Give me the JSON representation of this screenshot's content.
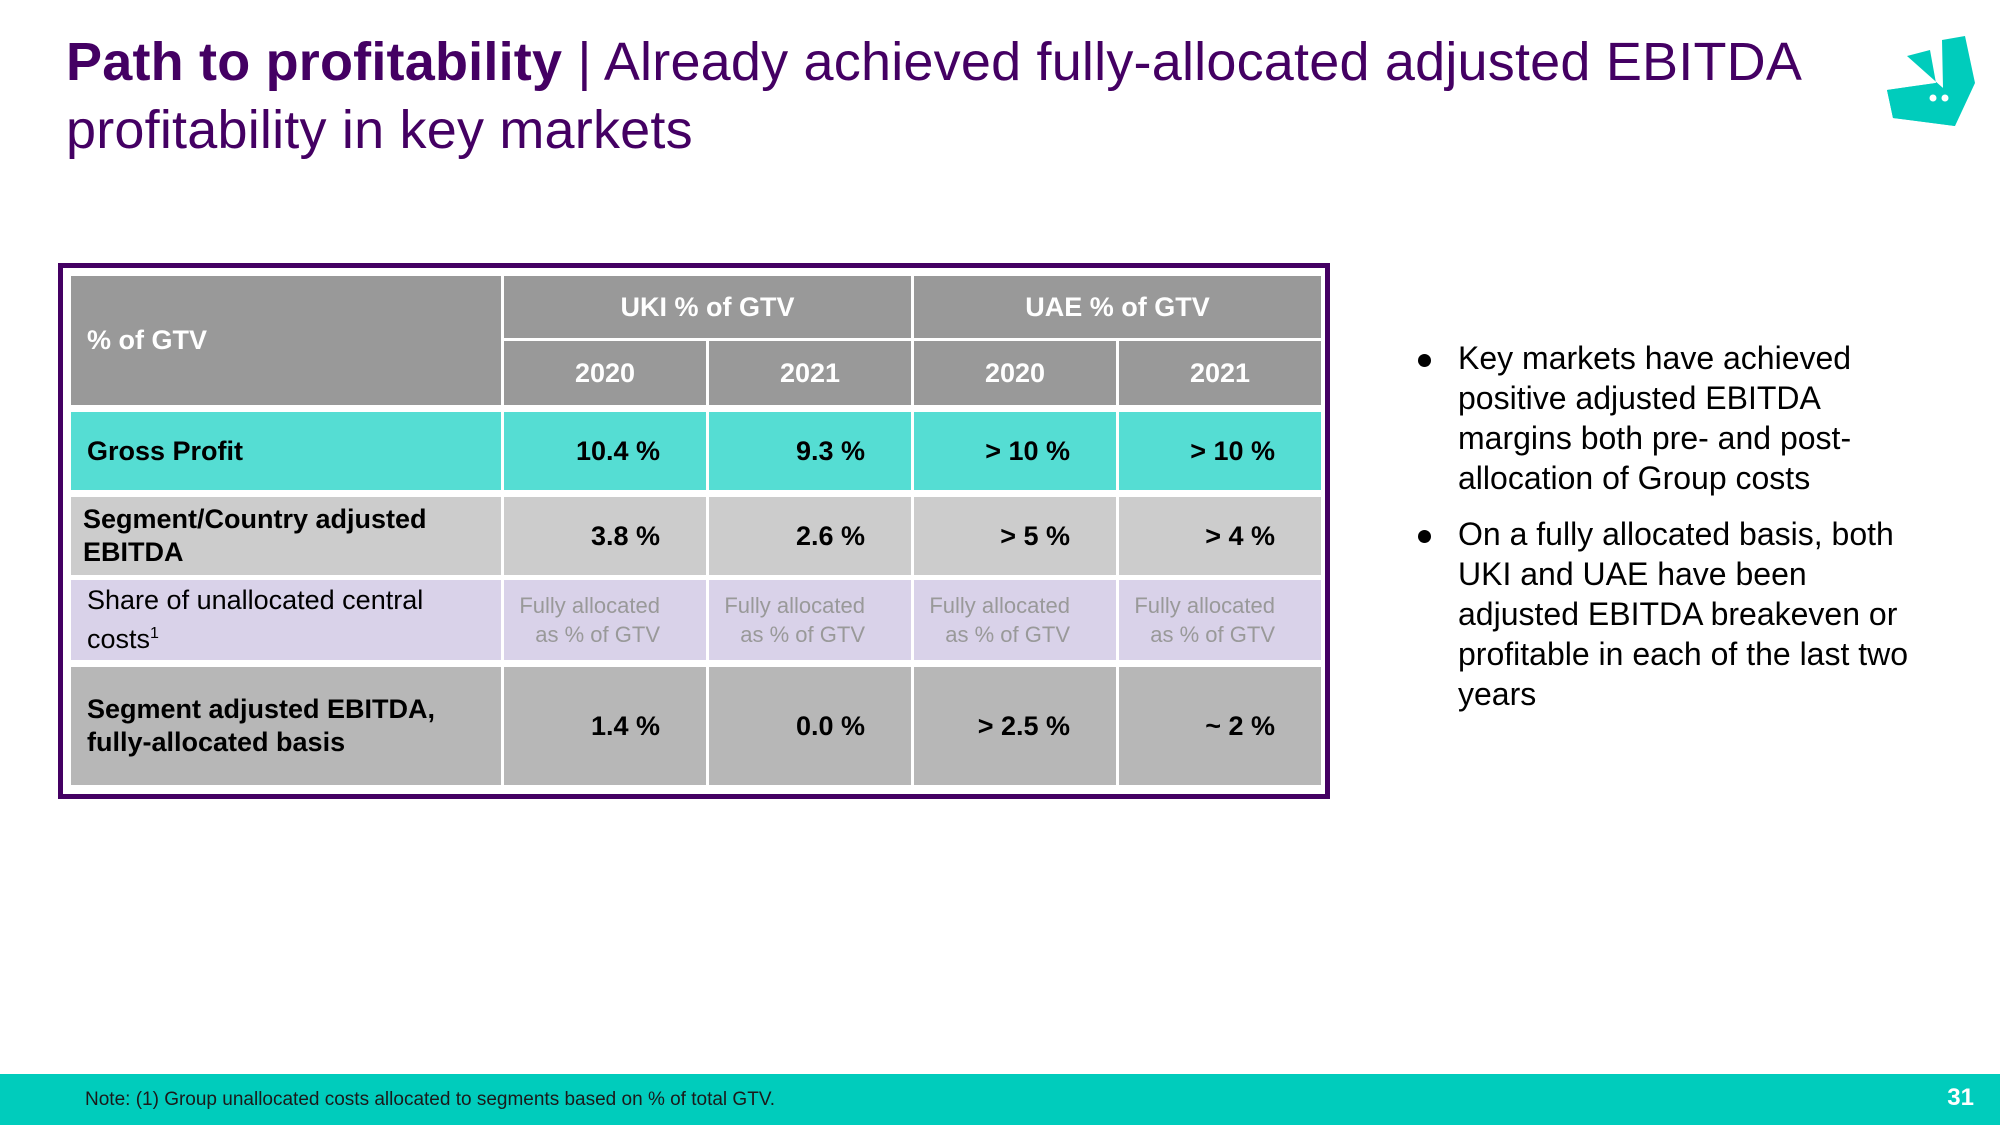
{
  "title": {
    "bold": "Path to profitability",
    "separator": " | ",
    "rest": "Already achieved fully-allocated adjusted EBITDA profitability in key markets"
  },
  "logo": {
    "icon": "deliveroo-kangaroo-logo",
    "color": "#00ccbc"
  },
  "table": {
    "corner_label": "% of GTV",
    "groups": [
      "UKI % of GTV",
      "UAE % of GTV"
    ],
    "years": [
      "2020",
      "2021",
      "2020",
      "2021"
    ],
    "rows": [
      {
        "label": "Gross Profit",
        "values": [
          "10.4 %",
          "9.3 %",
          "> 10 %",
          "> 10 %"
        ],
        "color": "#55ddd3"
      },
      {
        "label": "Segment/Country adjusted EBITDA",
        "values": [
          "3.8 %",
          "2.6 %",
          "> 5 %",
          "> 4 %"
        ],
        "color": "#cccccc"
      },
      {
        "label": "Share of unallocated central costs",
        "label_sup": "1",
        "values": [
          "Fully allocated as % of GTV",
          "Fully allocated as % of GTV",
          "Fully allocated as % of GTV",
          "Fully allocated as % of GTV"
        ],
        "color": "#d9d2e9"
      },
      {
        "label": "Segment adjusted EBITDA, fully-allocated basis",
        "values": [
          "1.4 %",
          "0.0 %",
          "> 2.5 %",
          "~ 2 %"
        ],
        "color": "#b7b7b7"
      }
    ],
    "header_color": "#999999",
    "frame_color": "#440063"
  },
  "bullets": [
    "Key markets have achieved positive adjusted EBITDA margins both pre- and post-allocation of Group costs",
    "On a fully allocated basis, both UKI and UAE have been adjusted EBITDA breakeven or profitable in each of the last two years"
  ],
  "footer": {
    "note": "Note: (1) Group unallocated costs allocated to segments based on % of total GTV.",
    "page_number": "31",
    "color": "#00ccbc"
  }
}
